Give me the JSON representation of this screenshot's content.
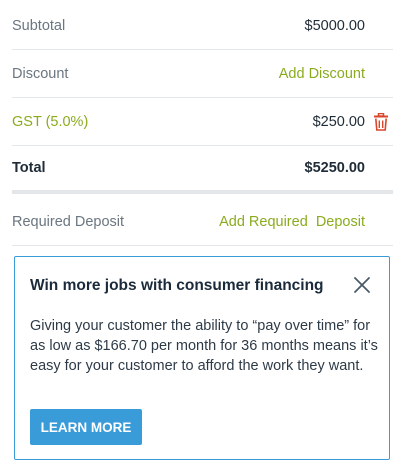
{
  "summary": {
    "subtotal": {
      "label": "Subtotal",
      "value": "$5000.00"
    },
    "discount": {
      "label": "Discount",
      "action": "Add Discount"
    },
    "gst": {
      "label": "GST (5.0%)",
      "value": "$250.00",
      "icon": "trash-icon"
    },
    "total": {
      "label": "Total",
      "value": "$5250.00"
    },
    "deposit": {
      "label": "Required Deposit",
      "action": "Add Required  Deposit"
    }
  },
  "promo": {
    "title": "Win more jobs with consumer financing",
    "body": "Giving your customer the ability to “pay over time” for as low as $166.70 per month for 36 months means it’s easy for your customer to afford the work they want.",
    "button": "LEARN MORE",
    "close_icon": "close-icon"
  },
  "colors": {
    "accent_green": "#8bab1f",
    "accent_blue": "#3a9bd9",
    "danger_red": "#d9472b"
  }
}
